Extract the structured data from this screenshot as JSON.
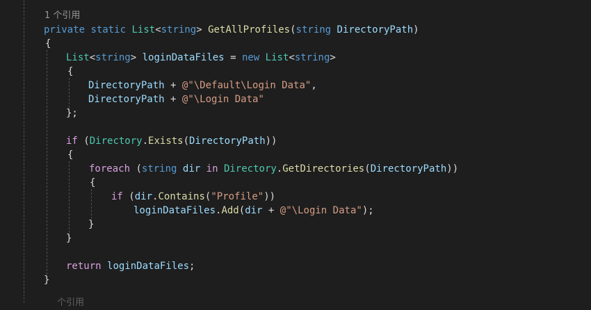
{
  "editor": {
    "codelens_refs": "1 个引用",
    "codelens_next": "个引用",
    "lines": {
      "sig": {
        "private": "private",
        "static": "static",
        "list_type": "List",
        "lt": "<",
        "string1": "string",
        "gt": ">",
        "method_name": "GetAllProfiles",
        "paren_open": "(",
        "string2": "string",
        "param_name": "DirectoryPath",
        "paren_close": ")"
      },
      "brace_open_method": "{",
      "decl": {
        "list_type": "List",
        "lt": "<",
        "string1": "string",
        "gt": ">",
        "var_name": "loginDataFiles",
        "eq": "=",
        "new": "new",
        "list_type2": "List",
        "lt2": "<",
        "string2": "string",
        "gt2": ">"
      },
      "brace_open_init": "{",
      "init1": {
        "param": "DirectoryPath",
        "plus": "+",
        "literal": "@\"\\Default\\Login Data\"",
        "comma": ","
      },
      "init2": {
        "param": "DirectoryPath",
        "plus": "+",
        "literal": "@\"\\Login Data\""
      },
      "brace_close_init": "};",
      "if1": {
        "if": "if",
        "paren_open": "(",
        "type": "Directory",
        "dot": ".",
        "method": "Exists",
        "paren_open2": "(",
        "param": "DirectoryPath",
        "paren_close": "))"
      },
      "brace_open_if": "{",
      "foreach": {
        "foreach": "foreach",
        "paren_open": "(",
        "string": "string",
        "var": "dir",
        "in": "in",
        "type": "Directory",
        "dot": ".",
        "method": "GetDirectories",
        "paren_open2": "(",
        "param": "DirectoryPath",
        "paren_close": "))"
      },
      "brace_open_foreach": "{",
      "if2": {
        "if": "if",
        "paren_open": "(",
        "var": "dir",
        "dot": ".",
        "method": "Contains",
        "paren_open2": "(",
        "literal": "\"Profile\"",
        "paren_close": "))"
      },
      "add": {
        "var": "loginDataFiles",
        "dot": ".",
        "method": "Add",
        "paren_open": "(",
        "dir": "dir",
        "plus": "+",
        "literal": "@\"\\Login Data\"",
        "end": ");"
      },
      "brace_close_foreach": "}",
      "brace_close_if": "}",
      "ret": {
        "return": "return",
        "var": "loginDataFiles",
        "semi": ";"
      },
      "brace_close_method": "}"
    }
  }
}
